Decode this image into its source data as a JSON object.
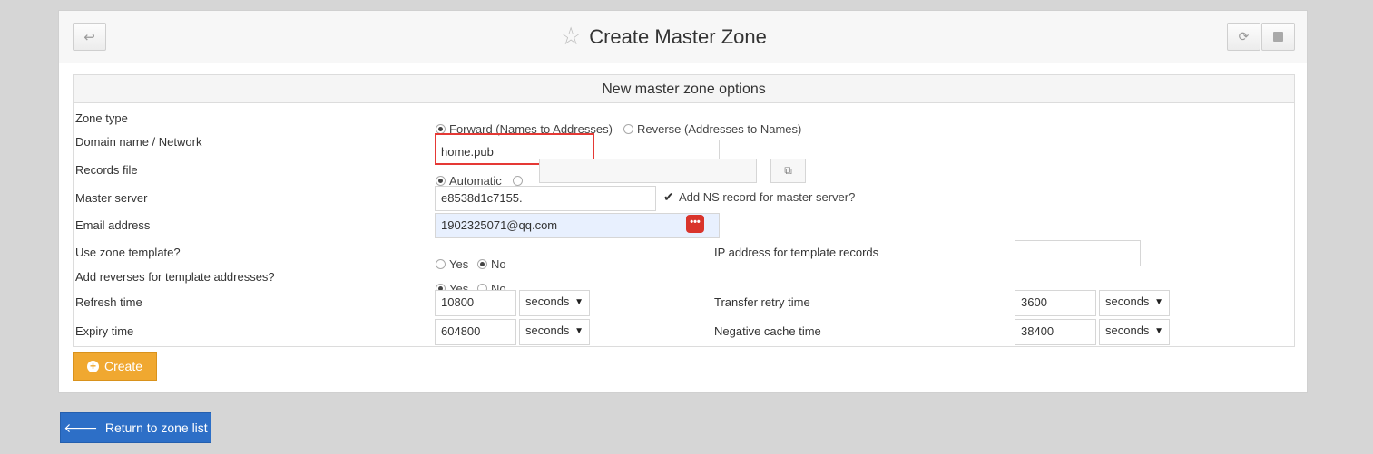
{
  "header": {
    "title": "Create Master Zone",
    "back_icon": "return-arrow-icon",
    "refresh_icon": "refresh-icon",
    "stop_icon": "stop-icon"
  },
  "section_title": "New master zone options",
  "form": {
    "zone_type": {
      "label": "Zone type",
      "options": [
        "Forward (Names to Addresses)",
        "Reverse (Addresses to Names)"
      ],
      "selected": "Forward (Names to Addresses)"
    },
    "domain": {
      "label": "Domain name / Network",
      "value": "home.pub"
    },
    "records_file": {
      "label": "Records file",
      "option_automatic": "Automatic",
      "selected": "Automatic",
      "value": ""
    },
    "master_server": {
      "label": "Master server",
      "value": "e8538d1c7155.",
      "add_ns_label": "Add NS record for master server?",
      "add_ns_checked": true
    },
    "email": {
      "label": "Email address",
      "value": "1902325071@qq.com"
    },
    "use_template": {
      "label": "Use zone template?",
      "yes": "Yes",
      "no": "No",
      "selected": "No"
    },
    "template_ip": {
      "label": "IP address for template records",
      "value": ""
    },
    "add_reverses": {
      "label": "Add reverses for template addresses?",
      "yes": "Yes",
      "no": "No",
      "selected": "Yes"
    },
    "refresh_time": {
      "label": "Refresh time",
      "value": "10800",
      "unit": "seconds"
    },
    "transfer_retry": {
      "label": "Transfer retry time",
      "value": "3600",
      "unit": "seconds"
    },
    "expiry_time": {
      "label": "Expiry time",
      "value": "604800",
      "unit": "seconds"
    },
    "negative_cache": {
      "label": "Negative cache time",
      "value": "38400",
      "unit": "seconds"
    }
  },
  "buttons": {
    "create": "Create",
    "return": "Return to zone list"
  },
  "colors": {
    "create_button": "#f0a830",
    "return_button": "#2d6fc7",
    "highlight_box": "#e53935"
  }
}
